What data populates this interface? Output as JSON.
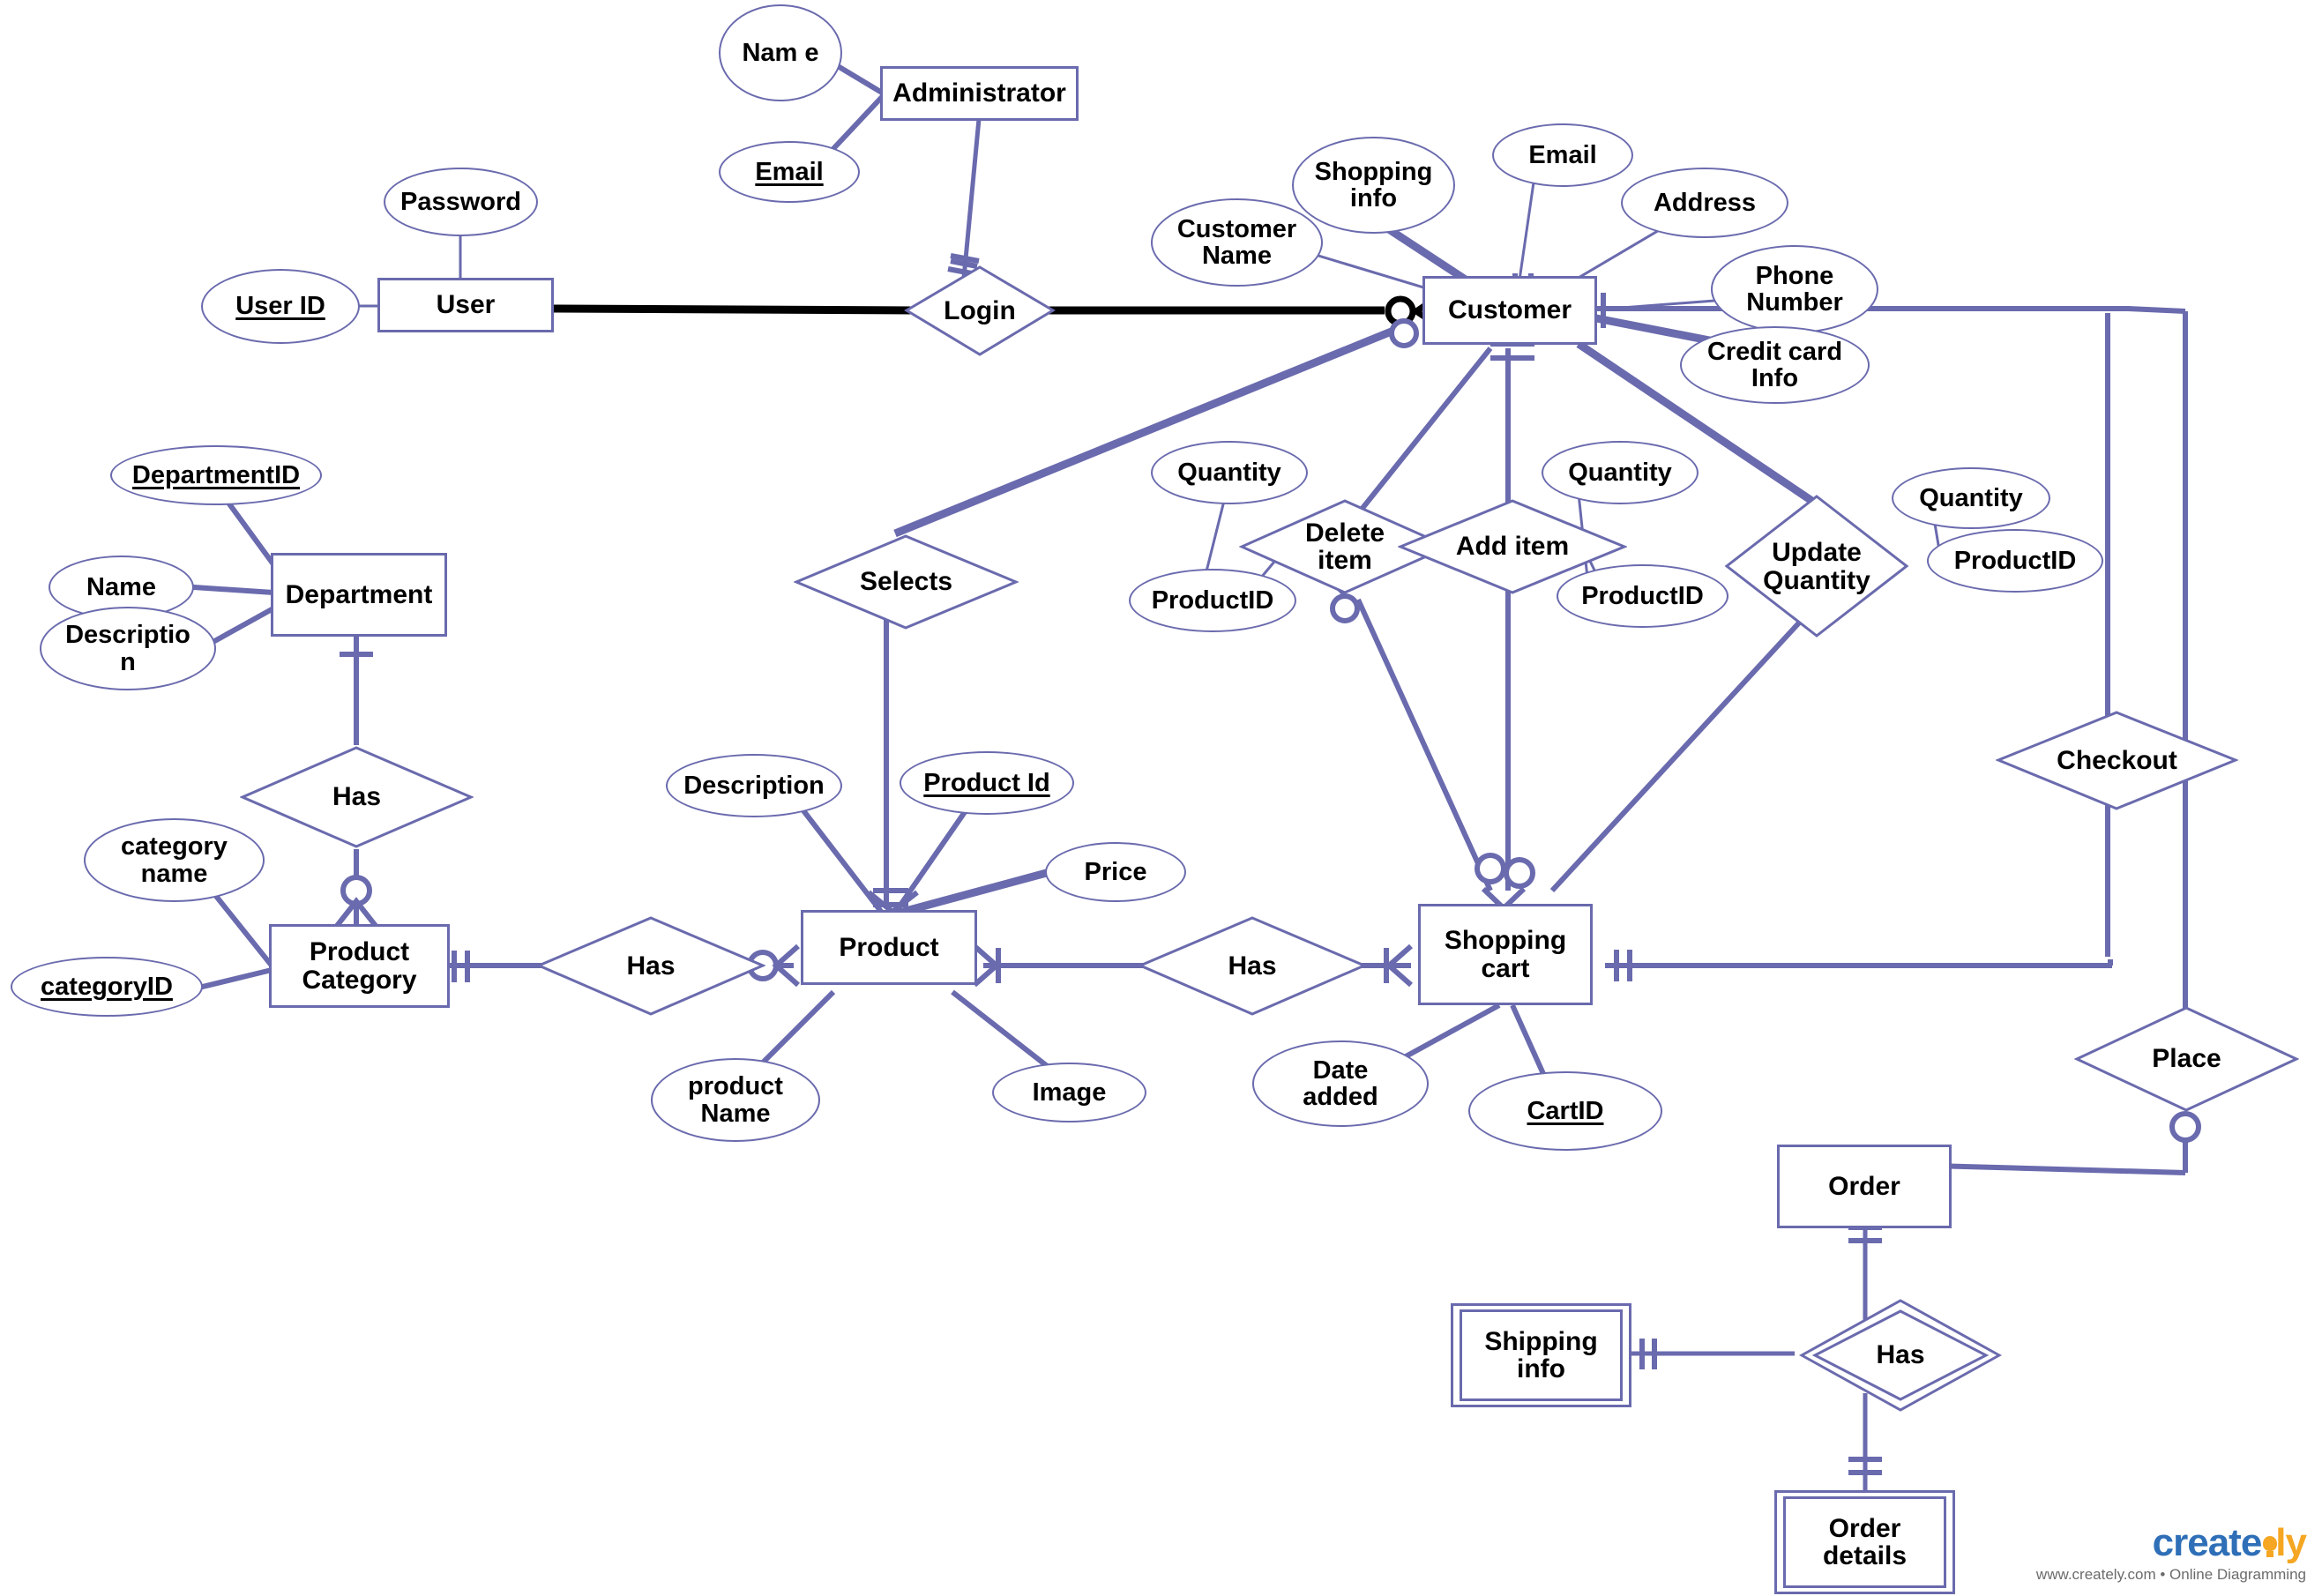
{
  "diagram": {
    "title": "Online Shopping ER Diagram",
    "colors": {
      "shape_stroke": "#6a6aae",
      "line": "#6a6aae",
      "login_line": "#000000",
      "text": "#000000",
      "background": "#ffffff"
    }
  },
  "entities": [
    {
      "id": "administrator",
      "label": "Administrator",
      "kind": "strong"
    },
    {
      "id": "user",
      "label": "User",
      "kind": "strong"
    },
    {
      "id": "customer",
      "label": "Customer",
      "kind": "strong"
    },
    {
      "id": "department",
      "label": "Department",
      "kind": "strong"
    },
    {
      "id": "product_category",
      "label": "Product\nCategory",
      "kind": "strong"
    },
    {
      "id": "product",
      "label": "Product",
      "kind": "strong"
    },
    {
      "id": "shopping_cart",
      "label": "Shopping\ncart",
      "kind": "strong"
    },
    {
      "id": "order",
      "label": "Order",
      "kind": "strong"
    },
    {
      "id": "shipping_info",
      "label": "Shipping\ninfo",
      "kind": "weak"
    },
    {
      "id": "order_details",
      "label": "Order\ndetails",
      "kind": "weak"
    }
  ],
  "relationships": [
    {
      "id": "login",
      "label": "Login",
      "kind": "normal"
    },
    {
      "id": "selects",
      "label": "Selects",
      "kind": "normal"
    },
    {
      "id": "delete_item",
      "label": "Delete\nitem",
      "kind": "normal"
    },
    {
      "id": "add_item",
      "label": "Add item",
      "kind": "normal"
    },
    {
      "id": "update_quantity",
      "label": "Update\nQuantity",
      "kind": "normal"
    },
    {
      "id": "checkout",
      "label": "Checkout",
      "kind": "normal"
    },
    {
      "id": "place",
      "label": "Place",
      "kind": "normal"
    },
    {
      "id": "has_dept_cat",
      "label": "Has",
      "kind": "normal"
    },
    {
      "id": "has_cat_prod",
      "label": "Has",
      "kind": "normal"
    },
    {
      "id": "has_prod_cart",
      "label": "Has",
      "kind": "normal"
    },
    {
      "id": "has_order_details",
      "label": "Has",
      "kind": "weak"
    }
  ],
  "attributes": [
    {
      "id": "admin_name",
      "label": "Nam\ne",
      "key": false,
      "owner": "administrator"
    },
    {
      "id": "admin_email",
      "label": "Email",
      "key": true,
      "owner": "administrator"
    },
    {
      "id": "user_password",
      "label": "Password",
      "key": false,
      "owner": "user"
    },
    {
      "id": "user_id",
      "label": "User ID",
      "key": true,
      "owner": "user"
    },
    {
      "id": "cust_name",
      "label": "Customer\nName",
      "key": false,
      "owner": "customer"
    },
    {
      "id": "cust_shopping",
      "label": "Shopping\ninfo",
      "key": false,
      "owner": "customer"
    },
    {
      "id": "cust_email",
      "label": "Email",
      "key": false,
      "owner": "customer"
    },
    {
      "id": "cust_address",
      "label": "Address",
      "key": false,
      "owner": "customer"
    },
    {
      "id": "cust_phone",
      "label": "Phone\nNumber",
      "key": false,
      "owner": "customer"
    },
    {
      "id": "cust_credit",
      "label": "Credit card\nInfo",
      "key": false,
      "owner": "customer"
    },
    {
      "id": "dept_id",
      "label": "DepartmentID",
      "key": true,
      "owner": "department"
    },
    {
      "id": "dept_name",
      "label": "Name",
      "key": false,
      "owner": "department"
    },
    {
      "id": "dept_desc",
      "label": "Descriptio\nn",
      "key": false,
      "owner": "department"
    },
    {
      "id": "cat_name",
      "label": "category\nname",
      "key": false,
      "owner": "product_category"
    },
    {
      "id": "cat_id",
      "label": "categoryID",
      "key": true,
      "owner": "product_category"
    },
    {
      "id": "prod_desc",
      "label": "Description",
      "key": false,
      "owner": "product"
    },
    {
      "id": "prod_id",
      "label": "Product Id",
      "key": true,
      "owner": "product"
    },
    {
      "id": "prod_price",
      "label": "Price",
      "key": false,
      "owner": "product"
    },
    {
      "id": "prod_name",
      "label": "product\nName",
      "key": false,
      "owner": "product"
    },
    {
      "id": "prod_image",
      "label": "Image",
      "key": false,
      "owner": "product"
    },
    {
      "id": "del_quantity",
      "label": "Quantity",
      "key": false,
      "owner": "delete_item"
    },
    {
      "id": "del_productid",
      "label": "ProductID",
      "key": false,
      "owner": "delete_item"
    },
    {
      "id": "add_quantity",
      "label": "Quantity",
      "key": false,
      "owner": "add_item"
    },
    {
      "id": "add_productid",
      "label": "ProductID",
      "key": false,
      "owner": "add_item"
    },
    {
      "id": "upd_quantity",
      "label": "Quantity",
      "key": false,
      "owner": "update_quantity"
    },
    {
      "id": "upd_productid",
      "label": "ProductID",
      "key": false,
      "owner": "update_quantity"
    },
    {
      "id": "cart_date",
      "label": "Date\nadded",
      "key": false,
      "owner": "shopping_cart"
    },
    {
      "id": "cart_id",
      "label": "CartID",
      "key": true,
      "owner": "shopping_cart"
    }
  ],
  "watermark": {
    "word_primary": "creat",
    "word_secondary": "e",
    "word_accent": "ly",
    "tagline": "www.creately.com • Online Diagramming",
    "color_primary": "#2e6fb7",
    "color_accent": "#f5a623"
  }
}
